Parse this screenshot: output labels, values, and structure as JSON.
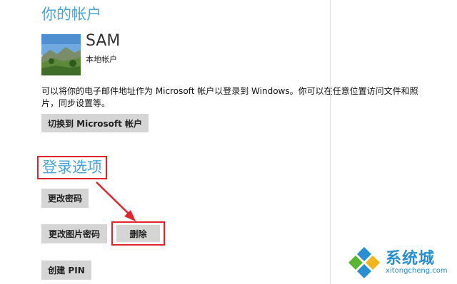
{
  "account": {
    "heading": "你的帐户",
    "username": "SAM",
    "account_type": "本地帐户",
    "description": "可以将你的电子邮件地址作为 Microsoft 帐户以登录到 Windows。你可以在任意位置访问文件和照片，同步设置等。",
    "switch_button": "切换到 Microsoft 帐户"
  },
  "signin_options": {
    "heading": "登录选项",
    "change_password": "更改密码",
    "change_picture_password": "更改图片密码",
    "delete": "删除",
    "create_pin": "创建 PIN"
  },
  "watermark": {
    "name": "系统城",
    "url": "xitongcheng.com"
  },
  "colors": {
    "heading": "#4aa5d6",
    "annotation_red": "#e0242b",
    "button_bg": "#d5d5d5",
    "watermark_blue": "#2a8fd0"
  }
}
